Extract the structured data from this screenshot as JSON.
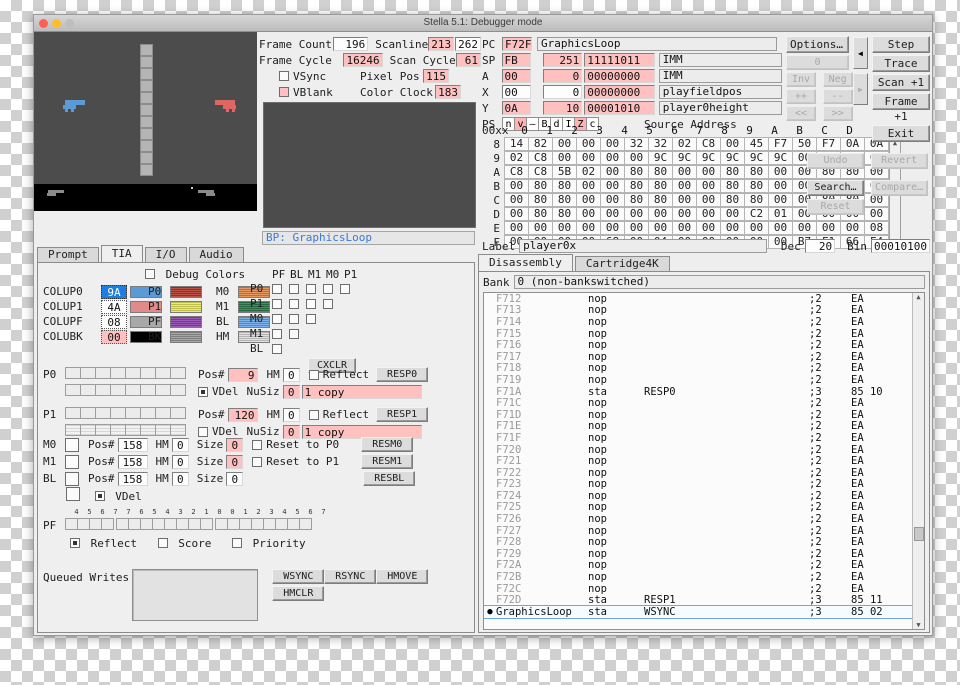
{
  "window": {
    "title": "Stella 5.1: Debugger mode"
  },
  "frame_info": {
    "frame_count_label": "Frame Count",
    "frame_count_value": "196",
    "frame_cycle_label": "Frame Cycle",
    "frame_cycle_value": "16246",
    "vsync_label": "VSync",
    "vblank_label": "VBlank",
    "scanline_label": "Scanline",
    "scanline_value": "213",
    "scanline_total": "262",
    "scan_cycle_label": "Scan Cycle",
    "scan_cycle_value": "61",
    "pixel_pos_label": "Pixel Pos",
    "pixel_pos_value": "115",
    "color_clock_label": "Color Clock",
    "color_clock_value": "183"
  },
  "breakpoint_line": "BP: GraphicsLoop",
  "cpu": {
    "pc_label": "PC",
    "pc_value": "F72F",
    "pc_source": "GraphicsLoop",
    "registers": [
      {
        "name": "SP",
        "hex": "FB",
        "dec": "251",
        "bin": "11111011",
        "src": "IMM",
        "hex_hl": true,
        "dec_hl": true,
        "bin_hl": true
      },
      {
        "name": "A",
        "hex": "00",
        "dec": "0",
        "bin": "00000000",
        "src": "IMM",
        "hex_hl": true,
        "dec_hl": true,
        "bin_hl": true
      },
      {
        "name": "X",
        "hex": "00",
        "dec": "0",
        "bin": "00000000",
        "src": "playfieldpos",
        "hex_hl": false,
        "dec_hl": false,
        "bin_hl": true
      },
      {
        "name": "Y",
        "hex": "0A",
        "dec": "10",
        "bin": "00001010",
        "src": "player0height",
        "hex_hl": true,
        "dec_hl": true,
        "bin_hl": true
      }
    ],
    "ps_label": "PS",
    "ps_flags": [
      {
        "c": "n",
        "on": false
      },
      {
        "c": "v",
        "on": true
      },
      {
        "c": "–",
        "on": false
      },
      {
        "c": "B",
        "on": false
      },
      {
        "c": "d",
        "on": false
      },
      {
        "c": "I",
        "on": false
      },
      {
        "c": "Z",
        "on": true
      },
      {
        "c": "c",
        "on": false
      }
    ],
    "source_address_label": "Source Address"
  },
  "memory": {
    "corner": "00xx",
    "columns": [
      "0",
      "1",
      "2",
      "3",
      "4",
      "5",
      "6",
      "7",
      "8",
      "9",
      "A",
      "B",
      "C",
      "D",
      "E",
      "F"
    ],
    "rows": [
      {
        "label": "8",
        "cells": [
          "14",
          "82",
          "00",
          "00",
          "00",
          "32",
          "32",
          "02",
          "C8",
          "00",
          "45",
          "F7",
          "50",
          "F7",
          "0A",
          "0A"
        ]
      },
      {
        "label": "9",
        "cells": [
          "02",
          "C8",
          "00",
          "00",
          "00",
          "00",
          "9C",
          "9C",
          "9C",
          "9C",
          "9C",
          "9C",
          "00",
          "32",
          "32",
          "02"
        ]
      },
      {
        "label": "A",
        "cells": [
          "C8",
          "C8",
          "5B",
          "02",
          "00",
          "80",
          "80",
          "00",
          "00",
          "80",
          "80",
          "00",
          "00",
          "80",
          "80",
          "00"
        ]
      },
      {
        "label": "B",
        "cells": [
          "00",
          "80",
          "80",
          "00",
          "00",
          "80",
          "80",
          "00",
          "00",
          "80",
          "80",
          "00",
          "00",
          "80",
          "80",
          "00"
        ]
      },
      {
        "label": "C",
        "cells": [
          "00",
          "80",
          "80",
          "00",
          "00",
          "80",
          "80",
          "00",
          "00",
          "80",
          "80",
          "00",
          "00",
          "80",
          "80",
          "00"
        ]
      },
      {
        "label": "D",
        "cells": [
          "00",
          "80",
          "80",
          "00",
          "00",
          "00",
          "00",
          "00",
          "00",
          "00",
          "C2",
          "01",
          "00",
          "00",
          "00",
          "00"
        ]
      },
      {
        "label": "E",
        "cells": [
          "00",
          "00",
          "00",
          "00",
          "00",
          "00",
          "00",
          "00",
          "00",
          "00",
          "00",
          "00",
          "00",
          "00",
          "00",
          "08"
        ]
      },
      {
        "label": "F",
        "cells": [
          "00",
          "00",
          "00",
          "00",
          "68",
          "00",
          "04",
          "00",
          "00",
          "00",
          "00",
          "00",
          "B7",
          "F1",
          "66",
          "F4"
        ]
      }
    ]
  },
  "label_bar": {
    "label_label": "Label",
    "label_value": "player0x",
    "dec_label": "Dec",
    "dec_value": "20",
    "bin_label": "Bin",
    "bin_value": "00010100"
  },
  "right_buttons": {
    "options": "Options…",
    "zero": "0",
    "inv": "Inv",
    "neg": "Neg",
    "inc": "++",
    "dec": "--",
    "shl": "<<",
    "shr": ">>",
    "step": "Step",
    "trace": "Trace",
    "scan_plus": "Scan +1",
    "frame_plus": "Frame +1",
    "exit": "Exit",
    "undo": "Undo",
    "revert": "Revert",
    "search": "Search…",
    "compare": "Compare…",
    "reset": "Reset",
    "left_arrow": "◀",
    "right_arrow": "▶"
  },
  "left_tabs": [
    {
      "label": "Prompt",
      "active": false
    },
    {
      "label": "TIA",
      "active": true
    },
    {
      "label": "I/O",
      "active": false
    },
    {
      "label": "Audio",
      "active": false
    }
  ],
  "right_tabs": [
    {
      "label": "Disassembly",
      "active": true
    },
    {
      "label": "Cartridge4K",
      "active": false
    }
  ],
  "bank": {
    "label": "Bank",
    "value": "0  (non-bankswitched)"
  },
  "tia": {
    "colors": [
      {
        "name": "COLUP0",
        "value": "9A",
        "swatch": "#5b9bd5",
        "selected": true
      },
      {
        "name": "COLUP1",
        "value": "4A",
        "swatch": "#e08a8a",
        "selected": false
      },
      {
        "name": "COLUPF",
        "value": "08",
        "swatch": "#a8a8a8",
        "selected": false
      },
      {
        "name": "COLUBK",
        "value": "00",
        "swatch": "#000000",
        "selected": false,
        "pink": true
      }
    ],
    "debug_colors_label": "Debug Colors",
    "debug_swatches": [
      {
        "name": "P0",
        "color": "#b03a2e"
      },
      {
        "name": "P1",
        "color": "#e8e85a"
      },
      {
        "name": "PF",
        "color": "#8e44ad"
      },
      {
        "name": "BK",
        "color": "#9a9a9a"
      },
      {
        "name": "M0",
        "color": "#e08a4a"
      },
      {
        "name": "M1",
        "color": "#2e7d4f"
      },
      {
        "name": "BL",
        "color": "#6aa6e8"
      },
      {
        "name": "HM",
        "color": "#dcdcdc"
      }
    ],
    "collision_cols": [
      "PF",
      "BL",
      "M1",
      "M0",
      "P1"
    ],
    "collision_rows": [
      {
        "name": "P0",
        "count": 5
      },
      {
        "name": "P1",
        "count": 4
      },
      {
        "name": "M0",
        "count": 3
      },
      {
        "name": "M1",
        "count": 2
      },
      {
        "name": "BL",
        "count": 1
      }
    ],
    "cxclr_label": "CXCLR",
    "players": [
      {
        "name": "P0",
        "pos_label": "Pos#",
        "pos_value": "9",
        "pos_hl": true,
        "hm_label": "HM",
        "hm_value": "0",
        "reflect_label": "Reflect",
        "reflect_on": false,
        "res_btn": "RESP0",
        "vdel_label": "VDel",
        "vdel_on": true,
        "nusiz_label": "NuSiz",
        "nusiz_value": "0",
        "nusiz_text": "1 copy",
        "striped": false
      },
      {
        "name": "P1",
        "pos_label": "Pos#",
        "pos_value": "120",
        "pos_hl": true,
        "hm_label": "HM",
        "hm_value": "0",
        "reflect_label": "Reflect",
        "reflect_on": false,
        "res_btn": "RESP1",
        "vdel_label": "VDel",
        "vdel_on": false,
        "nusiz_label": "NuSiz",
        "nusiz_value": "0",
        "nusiz_text": "1 copy",
        "striped": true
      }
    ],
    "objects": [
      {
        "name": "M0",
        "pos_label": "Pos#",
        "pos_value": "158",
        "hm_label": "HM",
        "hm_value": "0",
        "size_label": "Size",
        "size_value": "0",
        "size_hl": true,
        "reset_label": "Reset to P0",
        "reset_on": false,
        "res_btn": "RESM0"
      },
      {
        "name": "M1",
        "pos_label": "Pos#",
        "pos_value": "158",
        "hm_label": "HM",
        "hm_value": "0",
        "size_label": "Size",
        "size_value": "0",
        "size_hl": true,
        "reset_label": "Reset to P1",
        "reset_on": false,
        "res_btn": "RESM1"
      },
      {
        "name": "BL",
        "pos_label": "Pos#",
        "pos_value": "158",
        "hm_label": "HM",
        "hm_value": "0",
        "size_label": "Size",
        "size_value": "0",
        "size_hl": false,
        "reset_label": "",
        "reset_on": false,
        "res_btn": "RESBL"
      }
    ],
    "bl_vdel_label": "VDel",
    "pf_label": "PF",
    "pf_numbers": [
      "4",
      "5",
      "6",
      "7",
      "7",
      "6",
      "5",
      "4",
      "3",
      "2",
      "1",
      "0",
      "0",
      "1",
      "2",
      "3",
      "4",
      "5",
      "6",
      "7"
    ],
    "pf_reflect_label": "Reflect",
    "pf_reflect_on": true,
    "pf_score_label": "Score",
    "pf_score_on": false,
    "pf_priority_label": "Priority",
    "pf_priority_on": false,
    "queued_writes_label": "Queued Writes",
    "strobe_buttons": [
      "WSYNC",
      "RSYNC",
      "HMOVE",
      "HMCLR"
    ]
  },
  "disassembly": {
    "lines": [
      {
        "bp": "",
        "addr": "F712",
        "mnem": "nop",
        "oper": "",
        "cyc": ";2",
        "bytes": "EA",
        "sel": false
      },
      {
        "bp": "",
        "addr": "F713",
        "mnem": "nop",
        "oper": "",
        "cyc": ";2",
        "bytes": "EA",
        "sel": false
      },
      {
        "bp": "",
        "addr": "F714",
        "mnem": "nop",
        "oper": "",
        "cyc": ";2",
        "bytes": "EA",
        "sel": false
      },
      {
        "bp": "",
        "addr": "F715",
        "mnem": "nop",
        "oper": "",
        "cyc": ";2",
        "bytes": "EA",
        "sel": false
      },
      {
        "bp": "",
        "addr": "F716",
        "mnem": "nop",
        "oper": "",
        "cyc": ";2",
        "bytes": "EA",
        "sel": false
      },
      {
        "bp": "",
        "addr": "F717",
        "mnem": "nop",
        "oper": "",
        "cyc": ";2",
        "bytes": "EA",
        "sel": false
      },
      {
        "bp": "",
        "addr": "F718",
        "mnem": "nop",
        "oper": "",
        "cyc": ";2",
        "bytes": "EA",
        "sel": false
      },
      {
        "bp": "",
        "addr": "F719",
        "mnem": "nop",
        "oper": "",
        "cyc": ";2",
        "bytes": "EA",
        "sel": false
      },
      {
        "bp": "",
        "addr": "F71A",
        "mnem": "sta",
        "oper": "RESP0",
        "cyc": ";3",
        "bytes": "85 10",
        "sel": false
      },
      {
        "bp": "",
        "addr": "F71C",
        "mnem": "nop",
        "oper": "",
        "cyc": ";2",
        "bytes": "EA",
        "sel": false
      },
      {
        "bp": "",
        "addr": "F71D",
        "mnem": "nop",
        "oper": "",
        "cyc": ";2",
        "bytes": "EA",
        "sel": false
      },
      {
        "bp": "",
        "addr": "F71E",
        "mnem": "nop",
        "oper": "",
        "cyc": ";2",
        "bytes": "EA",
        "sel": false
      },
      {
        "bp": "",
        "addr": "F71F",
        "mnem": "nop",
        "oper": "",
        "cyc": ";2",
        "bytes": "EA",
        "sel": false
      },
      {
        "bp": "",
        "addr": "F720",
        "mnem": "nop",
        "oper": "",
        "cyc": ";2",
        "bytes": "EA",
        "sel": false
      },
      {
        "bp": "",
        "addr": "F721",
        "mnem": "nop",
        "oper": "",
        "cyc": ";2",
        "bytes": "EA",
        "sel": false
      },
      {
        "bp": "",
        "addr": "F722",
        "mnem": "nop",
        "oper": "",
        "cyc": ";2",
        "bytes": "EA",
        "sel": false
      },
      {
        "bp": "",
        "addr": "F723",
        "mnem": "nop",
        "oper": "",
        "cyc": ";2",
        "bytes": "EA",
        "sel": false
      },
      {
        "bp": "",
        "addr": "F724",
        "mnem": "nop",
        "oper": "",
        "cyc": ";2",
        "bytes": "EA",
        "sel": false
      },
      {
        "bp": "",
        "addr": "F725",
        "mnem": "nop",
        "oper": "",
        "cyc": ";2",
        "bytes": "EA",
        "sel": false
      },
      {
        "bp": "",
        "addr": "F726",
        "mnem": "nop",
        "oper": "",
        "cyc": ";2",
        "bytes": "EA",
        "sel": false
      },
      {
        "bp": "",
        "addr": "F727",
        "mnem": "nop",
        "oper": "",
        "cyc": ";2",
        "bytes": "EA",
        "sel": false
      },
      {
        "bp": "",
        "addr": "F728",
        "mnem": "nop",
        "oper": "",
        "cyc": ";2",
        "bytes": "EA",
        "sel": false
      },
      {
        "bp": "",
        "addr": "F729",
        "mnem": "nop",
        "oper": "",
        "cyc": ";2",
        "bytes": "EA",
        "sel": false
      },
      {
        "bp": "",
        "addr": "F72A",
        "mnem": "nop",
        "oper": "",
        "cyc": ";2",
        "bytes": "EA",
        "sel": false
      },
      {
        "bp": "",
        "addr": "F72B",
        "mnem": "nop",
        "oper": "",
        "cyc": ";2",
        "bytes": "EA",
        "sel": false
      },
      {
        "bp": "",
        "addr": "F72C",
        "mnem": "nop",
        "oper": "",
        "cyc": ";2",
        "bytes": "EA",
        "sel": false
      },
      {
        "bp": "",
        "addr": "F72D",
        "mnem": "sta",
        "oper": "RESP1",
        "cyc": ";3",
        "bytes": "85 11",
        "sel": false
      },
      {
        "bp": "●",
        "addr": "GraphicsLoop",
        "mnem": "sta",
        "oper": "WSYNC",
        "cyc": ";3",
        "bytes": "85 02",
        "sel": true
      }
    ]
  }
}
